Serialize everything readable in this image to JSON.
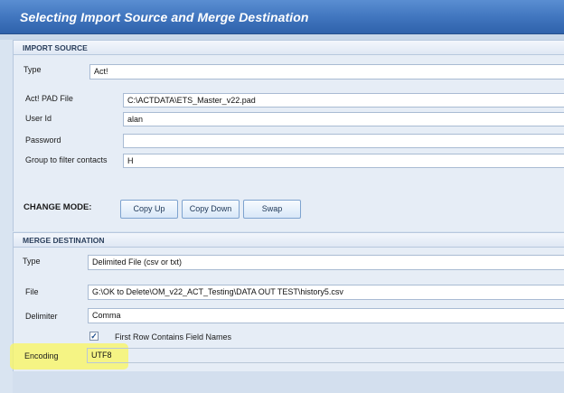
{
  "window": {
    "title": "Selecting Import Source and Merge Destination"
  },
  "import_source": {
    "header": "IMPORT SOURCE",
    "type_label": "Type",
    "type_value": "Act!",
    "pad_label": "Act! PAD File",
    "pad_value": "C:\\ACTDATA\\ETS_Master_v22.pad",
    "user_label": "User Id",
    "user_value": "alan",
    "password_label": "Password",
    "password_value": "",
    "group_label": "Group to filter contacts",
    "group_value": "H"
  },
  "change_mode": {
    "label": "CHANGE MODE:",
    "copy_up": "Copy Up",
    "copy_down": "Copy Down",
    "swap": "Swap"
  },
  "merge_destination": {
    "header": "MERGE DESTINATION",
    "type_label": "Type",
    "type_value": "Delimited File (csv or txt)",
    "file_label": "File",
    "file_value": "G:\\OK to Delete\\OM_v22_ACT_Testing\\DATA OUT TEST\\history5.csv",
    "delimiter_label": "Delimiter",
    "delimiter_value": "Comma",
    "first_row_label": "First Row Contains Field Names",
    "first_row_checked": true,
    "encoding_label": "Encoding",
    "encoding_value": "UTF8"
  },
  "colors": {
    "title_bar": "#3f74bd",
    "highlight": "#f8f664"
  }
}
